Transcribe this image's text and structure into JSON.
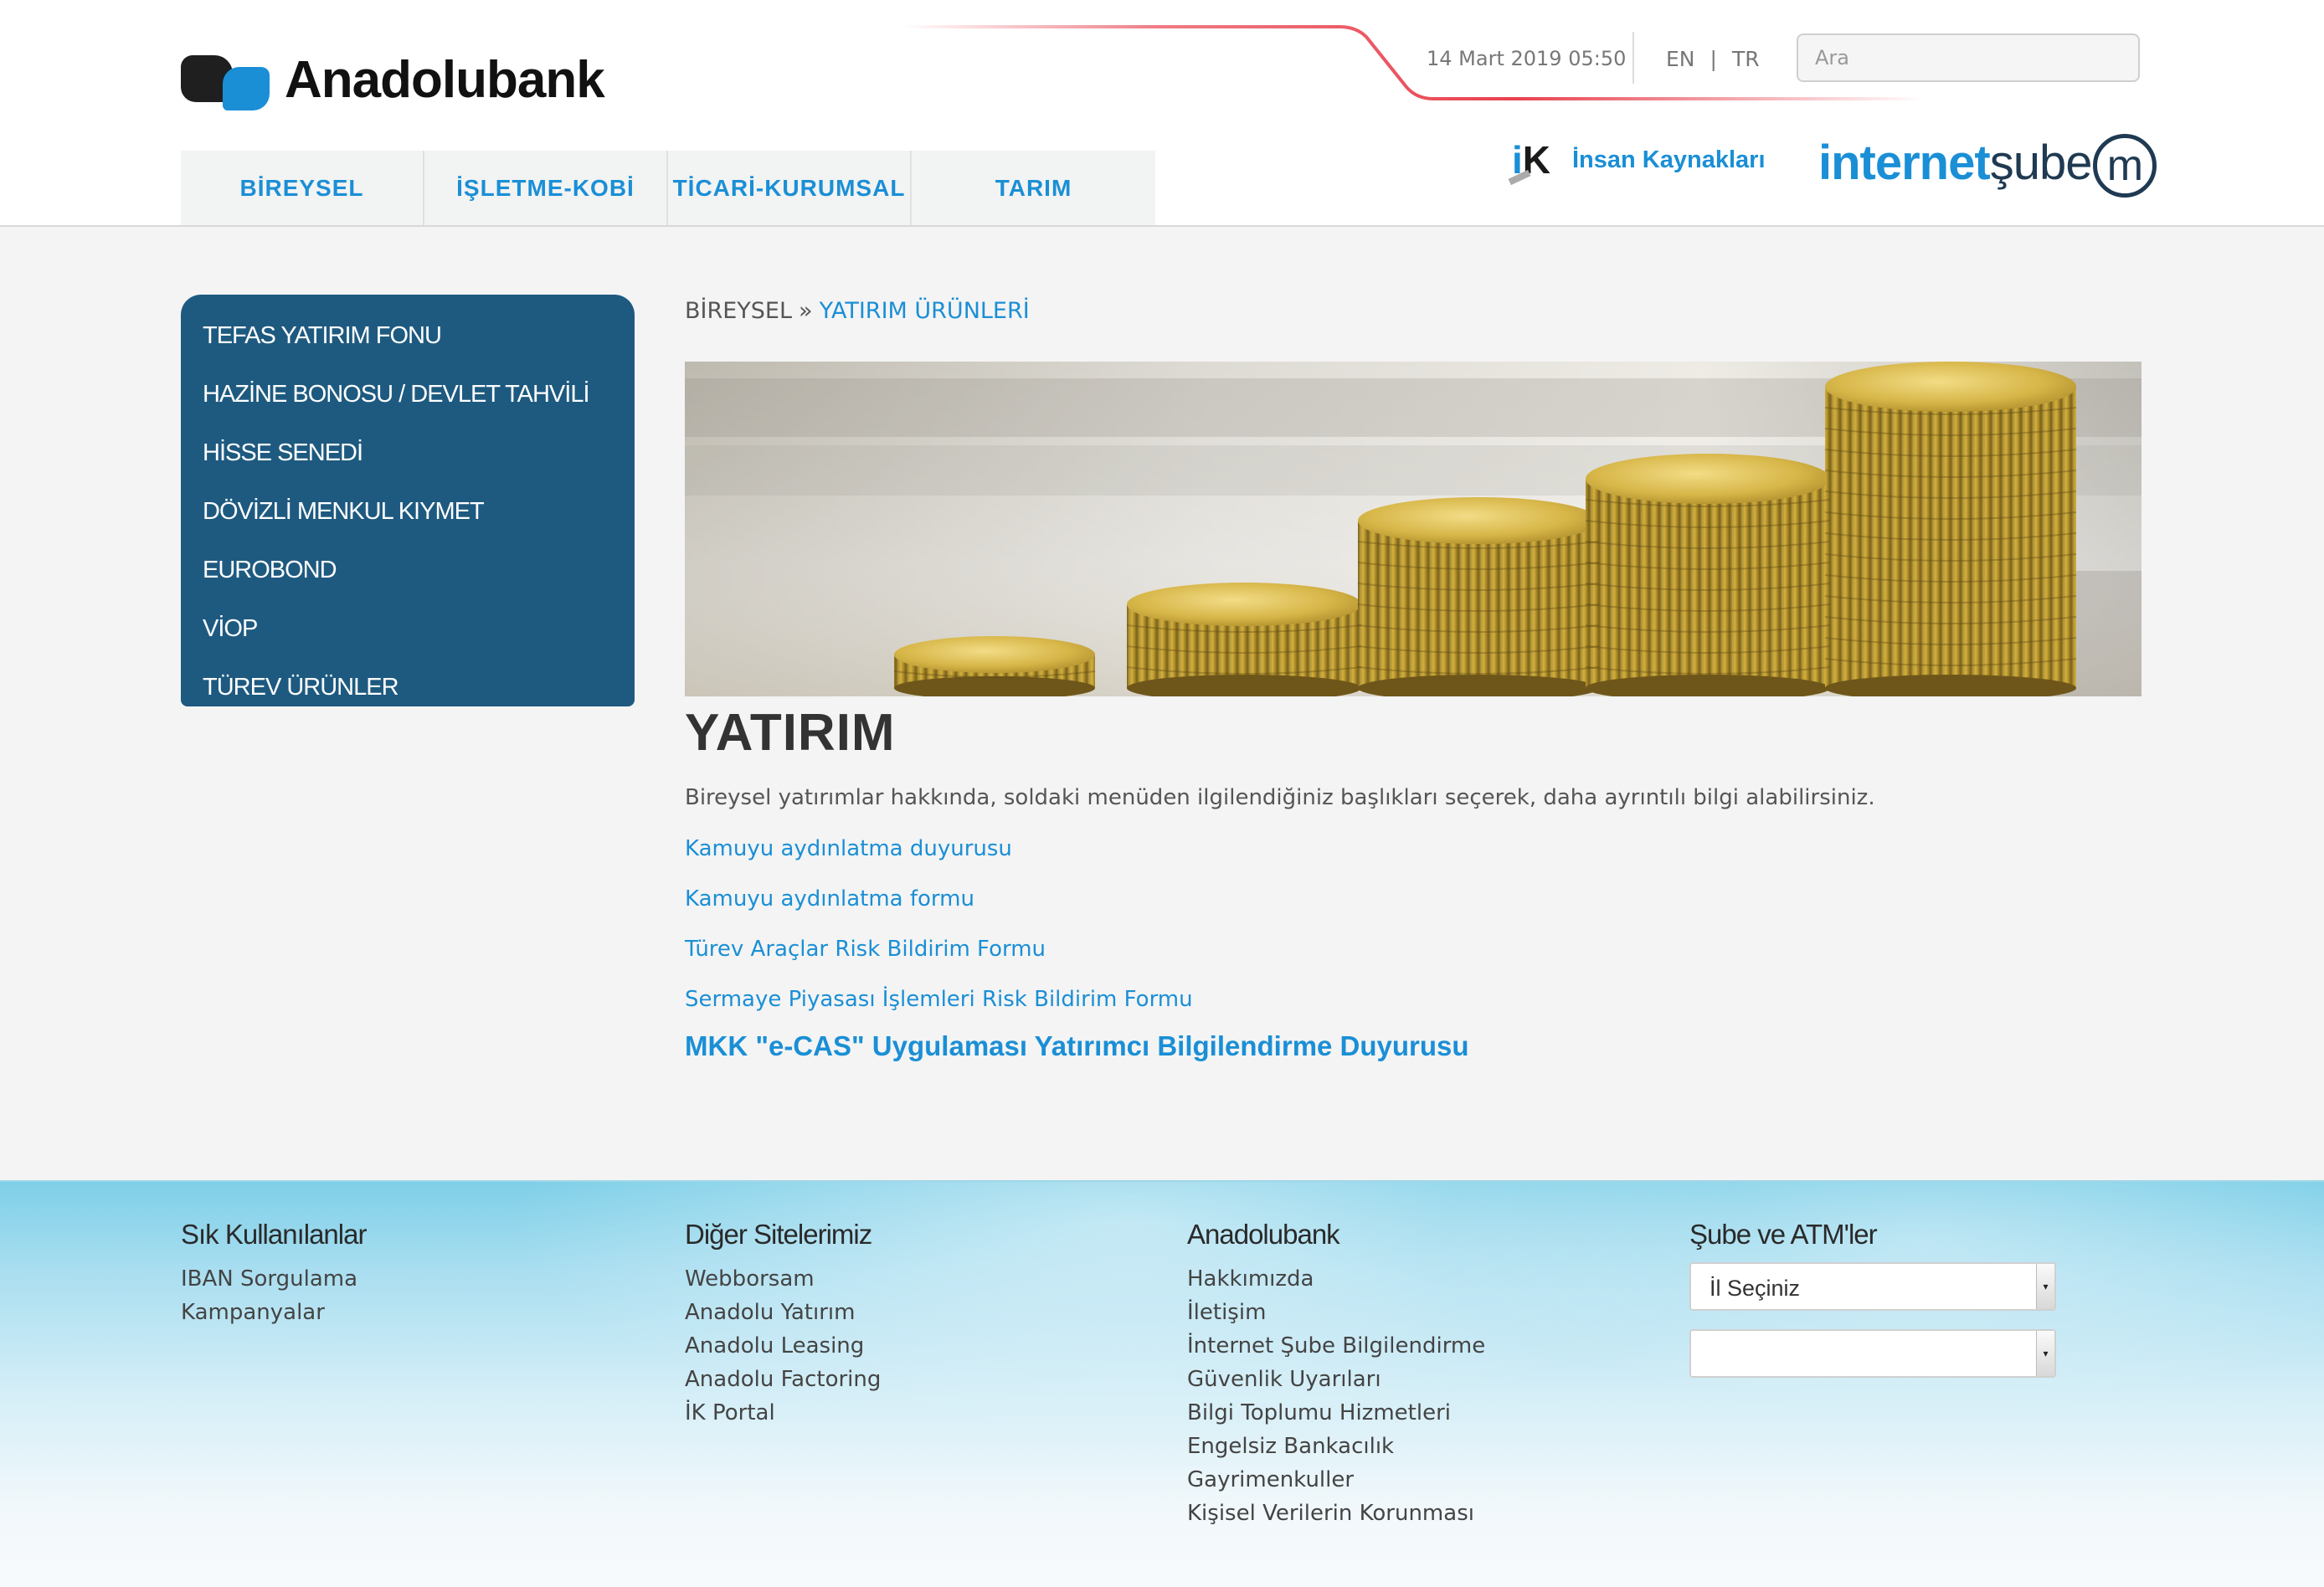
{
  "header": {
    "brand": "Anadolubank",
    "datetime": "14 Mart 2019 05:50",
    "lang": {
      "en": "EN",
      "separator": "|",
      "tr": "TR"
    },
    "search": {
      "placeholder": "Ara"
    },
    "ik": {
      "logo": "K",
      "label": "İnsan Kaynakları"
    },
    "internet_sube": {
      "part1": "internet",
      "part2": "şube",
      "m": "m"
    }
  },
  "topnav": {
    "tabs": [
      {
        "label": "BİREYSEL"
      },
      {
        "label": "İŞLETME-KOBİ"
      },
      {
        "label": "TİCARİ-KURUMSAL"
      },
      {
        "label": "TARIM"
      }
    ]
  },
  "sidemenu": {
    "items": [
      {
        "label": "TEFAS YATIRIM FONU"
      },
      {
        "label": "HAZİNE BONOSU / DEVLET TAHVİLİ"
      },
      {
        "label": "HİSSE SENEDİ"
      },
      {
        "label": "DÖVİZLİ MENKUL KIYMET"
      },
      {
        "label": "EUROBOND"
      },
      {
        "label": "VİOP"
      },
      {
        "label": "TÜREV ÜRÜNLER"
      }
    ]
  },
  "breadcrumb": {
    "root": "BİREYSEL",
    "separator": "»",
    "current": "YATIRIM ÜRÜNLERİ"
  },
  "main": {
    "title": "YATIRIM",
    "intro": "Bireysel yatırımlar hakkında, soldaki menüden ilgilendiğiniz başlıkları seçerek, daha ayrıntılı bilgi alabilirsiniz.",
    "links": [
      {
        "label": "Kamuyu aydınlatma duyurusu"
      },
      {
        "label": "Kamuyu aydınlatma formu"
      },
      {
        "label": "Türev Araçlar Risk Bildirim Formu"
      },
      {
        "label": "Sermaye Piyasası İşlemleri Risk Bildirim Formu"
      }
    ],
    "featured_link": "MKK \"e-CAS\" Uygulaması Yatırımcı Bilgilendirme Duyurusu"
  },
  "footer": {
    "col1": {
      "title": "Sık Kullanılanlar",
      "links": [
        "IBAN Sorgulama",
        "Kampanyalar"
      ]
    },
    "col2": {
      "title": "Diğer Sitelerimiz",
      "links": [
        "Webborsam",
        "Anadolu Yatırım",
        "Anadolu Leasing",
        "Anadolu Factoring",
        "İK Portal"
      ]
    },
    "col3": {
      "title": "Anadolubank",
      "links": [
        "Hakkımızda",
        "İletişim",
        "İnternet Şube Bilgilendirme",
        "Güvenlik Uyarıları",
        "Bilgi Toplumu Hizmetleri",
        "Engelsiz Bankacılık",
        "Gayrimenkuller",
        "Kişisel Verilerin Korunması"
      ]
    },
    "col4": {
      "title": "Şube ve ATM'ler",
      "city_select": "İl Seçiniz",
      "district_select": ""
    }
  },
  "colors": {
    "accent": "#1a8fd6",
    "sidemenu_bg": "#1e5a80",
    "swoosh": "#e8424f"
  },
  "icons": {
    "arrow": "select-arrow-icon"
  }
}
